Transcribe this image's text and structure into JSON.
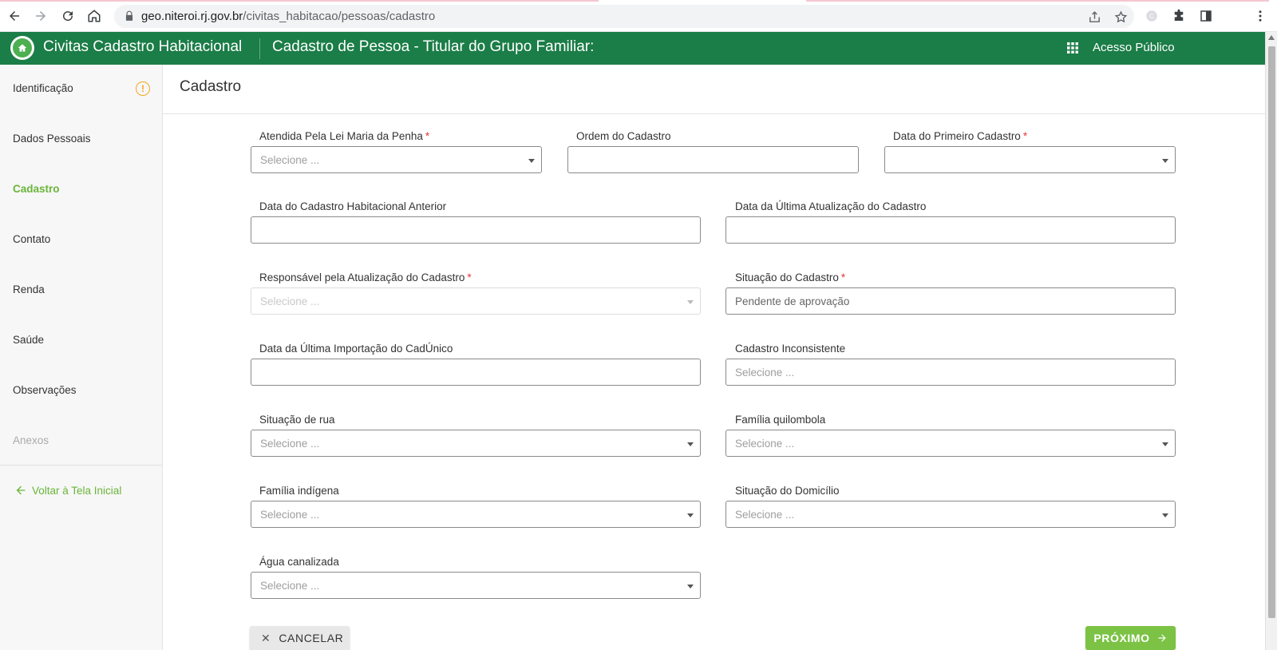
{
  "browser": {
    "url_host": "geo.niteroi.rj.gov.br",
    "url_path": "/civitas_habitacao/pessoas/cadastro"
  },
  "header": {
    "app_title": "Civitas Cadastro Habitacional",
    "page_title": "Cadastro de Pessoa - Titular do Grupo Familiar:",
    "access_label": "Acesso Público",
    "brand_color": "#1b7d47"
  },
  "sidebar": {
    "items": [
      {
        "label": "Identificação",
        "state": "warning"
      },
      {
        "label": "Dados Pessoais",
        "state": "normal"
      },
      {
        "label": "Cadastro",
        "state": "active"
      },
      {
        "label": "Contato",
        "state": "normal"
      },
      {
        "label": "Renda",
        "state": "normal"
      },
      {
        "label": "Saúde",
        "state": "normal"
      },
      {
        "label": "Observações",
        "state": "normal"
      },
      {
        "label": "Anexos",
        "state": "disabled"
      }
    ],
    "warning_symbol": "!",
    "back_label": "Voltar à Tela Inicial",
    "accent_color": "#6ab53a"
  },
  "main": {
    "section_title": "Cadastro",
    "fields": {
      "lei_maria_penha": {
        "label": "Atendida Pela Lei Maria da Penha",
        "required": "*",
        "placeholder": "Selecione ..."
      },
      "ordem_cadastro": {
        "label": "Ordem do Cadastro"
      },
      "data_primeiro_cadastro": {
        "label": "Data do Primeiro Cadastro",
        "required": "*"
      },
      "data_cadastro_anterior": {
        "label": "Data do Cadastro Habitacional Anterior"
      },
      "data_ultima_atualizacao": {
        "label": "Data da Última Atualização do Cadastro"
      },
      "responsavel_atualizacao": {
        "label": "Responsável pela Atualização do Cadastro",
        "required": "*",
        "placeholder": "Selecione ..."
      },
      "situacao_cadastro": {
        "label": "Situação do Cadastro",
        "required": "*",
        "value": "Pendente de aprovação"
      },
      "data_importacao_cadunico": {
        "label": "Data da Última Importação do CadÚnico"
      },
      "cadastro_inconsistente": {
        "label": "Cadastro Inconsistente",
        "placeholder": "Selecione ..."
      },
      "situacao_rua": {
        "label": "Situação de rua",
        "placeholder": "Selecione ..."
      },
      "familia_quilombola": {
        "label": "Família quilombola",
        "placeholder": "Selecione ..."
      },
      "familia_indigena": {
        "label": "Família indígena",
        "placeholder": "Selecione ..."
      },
      "situacao_domicilio": {
        "label": "Situação do Domicílio",
        "placeholder": "Selecione ..."
      },
      "agua_canalizada": {
        "label": "Água canalizada",
        "placeholder": "Selecione ..."
      }
    },
    "buttons": {
      "cancel_label": "CANCELAR",
      "next_label": "PRÓXIMO"
    }
  }
}
